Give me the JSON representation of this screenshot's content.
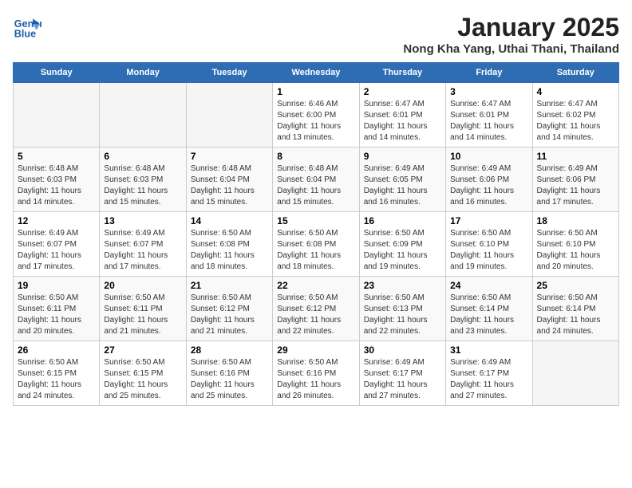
{
  "header": {
    "logo_line1": "General",
    "logo_line2": "Blue",
    "title": "January 2025",
    "subtitle": "Nong Kha Yang, Uthai Thani, Thailand"
  },
  "days_of_week": [
    "Sunday",
    "Monday",
    "Tuesday",
    "Wednesday",
    "Thursday",
    "Friday",
    "Saturday"
  ],
  "weeks": [
    [
      {
        "day": "",
        "info": ""
      },
      {
        "day": "",
        "info": ""
      },
      {
        "day": "",
        "info": ""
      },
      {
        "day": "1",
        "info": "Sunrise: 6:46 AM\nSunset: 6:00 PM\nDaylight: 11 hours\nand 13 minutes."
      },
      {
        "day": "2",
        "info": "Sunrise: 6:47 AM\nSunset: 6:01 PM\nDaylight: 11 hours\nand 14 minutes."
      },
      {
        "day": "3",
        "info": "Sunrise: 6:47 AM\nSunset: 6:01 PM\nDaylight: 11 hours\nand 14 minutes."
      },
      {
        "day": "4",
        "info": "Sunrise: 6:47 AM\nSunset: 6:02 PM\nDaylight: 11 hours\nand 14 minutes."
      }
    ],
    [
      {
        "day": "5",
        "info": "Sunrise: 6:48 AM\nSunset: 6:03 PM\nDaylight: 11 hours\nand 14 minutes."
      },
      {
        "day": "6",
        "info": "Sunrise: 6:48 AM\nSunset: 6:03 PM\nDaylight: 11 hours\nand 15 minutes."
      },
      {
        "day": "7",
        "info": "Sunrise: 6:48 AM\nSunset: 6:04 PM\nDaylight: 11 hours\nand 15 minutes."
      },
      {
        "day": "8",
        "info": "Sunrise: 6:48 AM\nSunset: 6:04 PM\nDaylight: 11 hours\nand 15 minutes."
      },
      {
        "day": "9",
        "info": "Sunrise: 6:49 AM\nSunset: 6:05 PM\nDaylight: 11 hours\nand 16 minutes."
      },
      {
        "day": "10",
        "info": "Sunrise: 6:49 AM\nSunset: 6:06 PM\nDaylight: 11 hours\nand 16 minutes."
      },
      {
        "day": "11",
        "info": "Sunrise: 6:49 AM\nSunset: 6:06 PM\nDaylight: 11 hours\nand 17 minutes."
      }
    ],
    [
      {
        "day": "12",
        "info": "Sunrise: 6:49 AM\nSunset: 6:07 PM\nDaylight: 11 hours\nand 17 minutes."
      },
      {
        "day": "13",
        "info": "Sunrise: 6:49 AM\nSunset: 6:07 PM\nDaylight: 11 hours\nand 17 minutes."
      },
      {
        "day": "14",
        "info": "Sunrise: 6:50 AM\nSunset: 6:08 PM\nDaylight: 11 hours\nand 18 minutes."
      },
      {
        "day": "15",
        "info": "Sunrise: 6:50 AM\nSunset: 6:08 PM\nDaylight: 11 hours\nand 18 minutes."
      },
      {
        "day": "16",
        "info": "Sunrise: 6:50 AM\nSunset: 6:09 PM\nDaylight: 11 hours\nand 19 minutes."
      },
      {
        "day": "17",
        "info": "Sunrise: 6:50 AM\nSunset: 6:10 PM\nDaylight: 11 hours\nand 19 minutes."
      },
      {
        "day": "18",
        "info": "Sunrise: 6:50 AM\nSunset: 6:10 PM\nDaylight: 11 hours\nand 20 minutes."
      }
    ],
    [
      {
        "day": "19",
        "info": "Sunrise: 6:50 AM\nSunset: 6:11 PM\nDaylight: 11 hours\nand 20 minutes."
      },
      {
        "day": "20",
        "info": "Sunrise: 6:50 AM\nSunset: 6:11 PM\nDaylight: 11 hours\nand 21 minutes."
      },
      {
        "day": "21",
        "info": "Sunrise: 6:50 AM\nSunset: 6:12 PM\nDaylight: 11 hours\nand 21 minutes."
      },
      {
        "day": "22",
        "info": "Sunrise: 6:50 AM\nSunset: 6:12 PM\nDaylight: 11 hours\nand 22 minutes."
      },
      {
        "day": "23",
        "info": "Sunrise: 6:50 AM\nSunset: 6:13 PM\nDaylight: 11 hours\nand 22 minutes."
      },
      {
        "day": "24",
        "info": "Sunrise: 6:50 AM\nSunset: 6:14 PM\nDaylight: 11 hours\nand 23 minutes."
      },
      {
        "day": "25",
        "info": "Sunrise: 6:50 AM\nSunset: 6:14 PM\nDaylight: 11 hours\nand 24 minutes."
      }
    ],
    [
      {
        "day": "26",
        "info": "Sunrise: 6:50 AM\nSunset: 6:15 PM\nDaylight: 11 hours\nand 24 minutes."
      },
      {
        "day": "27",
        "info": "Sunrise: 6:50 AM\nSunset: 6:15 PM\nDaylight: 11 hours\nand 25 minutes."
      },
      {
        "day": "28",
        "info": "Sunrise: 6:50 AM\nSunset: 6:16 PM\nDaylight: 11 hours\nand 25 minutes."
      },
      {
        "day": "29",
        "info": "Sunrise: 6:50 AM\nSunset: 6:16 PM\nDaylight: 11 hours\nand 26 minutes."
      },
      {
        "day": "30",
        "info": "Sunrise: 6:49 AM\nSunset: 6:17 PM\nDaylight: 11 hours\nand 27 minutes."
      },
      {
        "day": "31",
        "info": "Sunrise: 6:49 AM\nSunset: 6:17 PM\nDaylight: 11 hours\nand 27 minutes."
      },
      {
        "day": "",
        "info": ""
      }
    ]
  ]
}
